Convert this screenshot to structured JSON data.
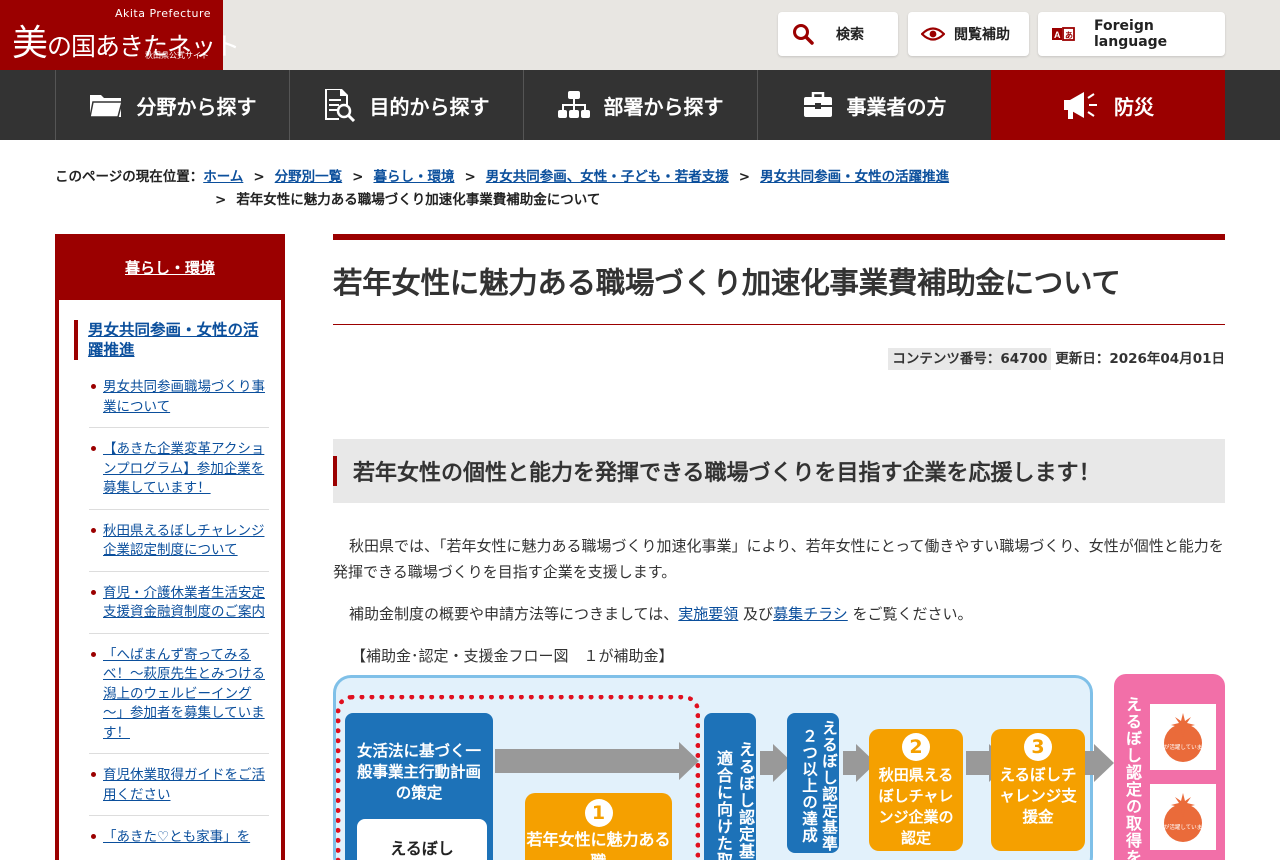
{
  "header": {
    "logo_main": "美の国あきたネット",
    "logo_big_char": "美",
    "logo_rest": "の国あきたネット",
    "logo_en": "Akita Prefecture",
    "logo_sub": "秋田県公式サイト",
    "search_label": "検索",
    "assist_label": "閲覧補助",
    "foreign_label": "Foreign language"
  },
  "nav": {
    "items": [
      {
        "label": "分野から探す",
        "icon": "folder-icon"
      },
      {
        "label": "目的から探す",
        "icon": "document-search-icon"
      },
      {
        "label": "部署から探す",
        "icon": "org-chart-icon"
      },
      {
        "label": "事業者の方",
        "icon": "briefcase-icon"
      },
      {
        "label": "防災",
        "icon": "megaphone-icon"
      }
    ]
  },
  "breadcrumb": {
    "prefix": "このページの現在位置：",
    "sep": ">",
    "links": [
      "ホーム",
      "分野別一覧",
      "暮らし・環境",
      "男女共同参画、女性・子ども・若者支援",
      "男女共同参画・女性の活躍推進"
    ],
    "current": "若年女性に魅力ある職場づくり加速化事業費補助金について"
  },
  "sidebar": {
    "heading": "暮らし・環境",
    "current": "男女共同参画・女性の活躍推進",
    "items": [
      "男女共同参画職場づくり事業について",
      "【あきた企業変革アクションプログラム】参加企業を募集しています！",
      "秋田県えるぼしチャレンジ企業認定制度について",
      "育児・介護休業者生活安定支援資金融資制度のご案内",
      "「へばまんず寄ってみるべ！～萩原先生とみつける潟上のウェルビーイング～」参加者を募集しています！",
      "育児休業取得ガイドをご活用ください",
      "「あきた♡とも家事」を"
    ]
  },
  "main": {
    "title": "若年女性に魅力ある職場づくり加速化事業費補助金について",
    "content_no_label": "コンテンツ番号：64700",
    "updated_label": "更新日：2026年04月01日",
    "section_heading": "若年女性の個性と能力を発揮できる職場づくりを目指す企業を応援します！",
    "para1": "秋田県では、「若年女性に魅力ある職場づくり加速化事業」により、若年女性にとって働きやすい職場づくり、女性が個性と能力を発揮できる職場づくりを目指す企業を支援します。",
    "para2_pre": "補助金制度の概要や申請方法等につきましては、",
    "para2_link1": "実施要領",
    "para2_mid": " 及び",
    "para2_link2": "募集チラシ",
    "para2_post": " をご覧ください。",
    "flow_caption": "【補助金･認定・支援金フロー図　１が補助金】"
  },
  "flow": {
    "box_plan": "女活法に基づく一般事業主行動計画の策定",
    "box_eruboshi": "えるぼし",
    "box_step1_num": "1",
    "box_step1": "若年女性に魅力ある職",
    "vbox_a": "えるぼし認定基準適合に向けた取",
    "vbox_b": "えるぼし認定基準２つ以上の達成",
    "box_step2_num": "2",
    "box_step2": "秋田県えるぼしチャレンジ企業の認定",
    "box_step3_num": "3",
    "box_step3": "えるぼしチャレンジ支援金",
    "vbox_pink": "えるぼし認定の取得を",
    "badge_text": "女性が活躍しています！"
  },
  "colors": {
    "brand_red": "#9b0000",
    "nav_bg": "#333333",
    "link": "#0b4f9c",
    "flow_blue": "#1d72b8",
    "flow_orange": "#f5a000",
    "flow_pink": "#f26fa8"
  }
}
